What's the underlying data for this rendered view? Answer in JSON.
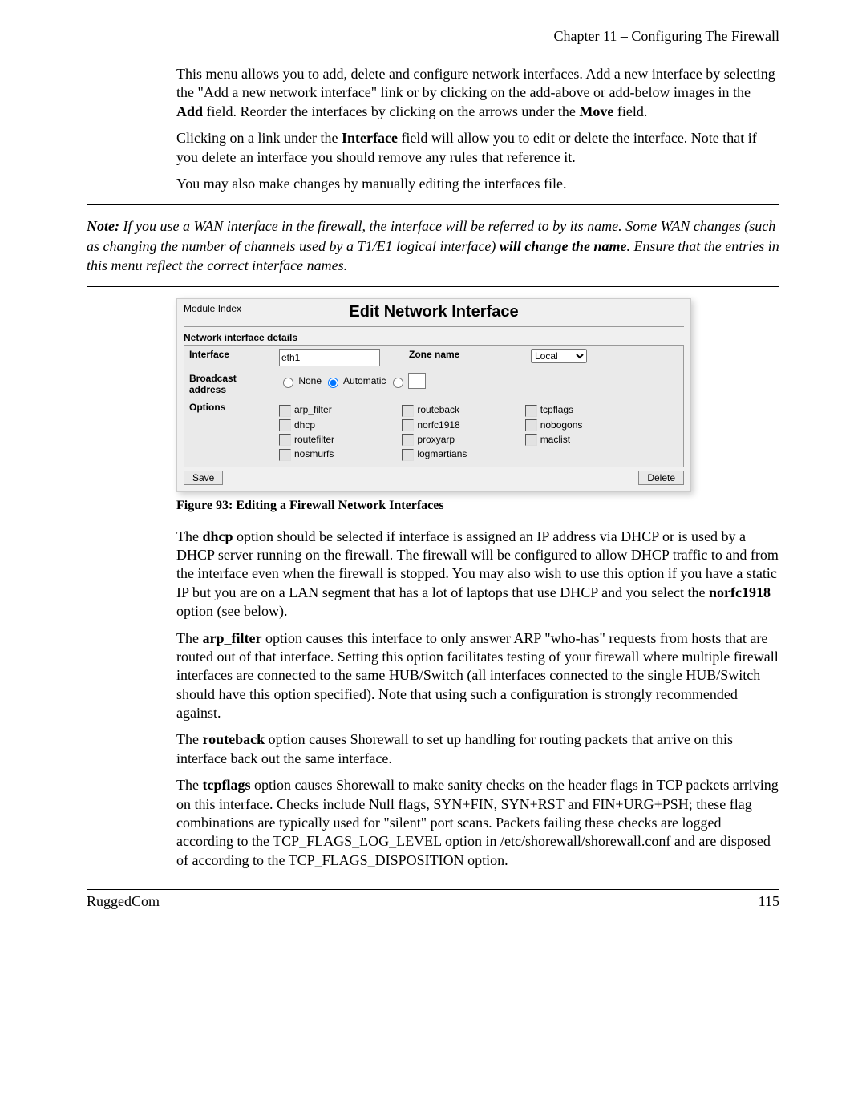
{
  "header": {
    "chapter": "Chapter 11 – Configuring The Firewall"
  },
  "intro": {
    "p1a": "This menu allows you to add, delete and configure network interfaces.  Add a new interface by selecting the \"Add a new network interface\" link or by clicking on the add-above or add-below images in the ",
    "p1b": "Add",
    "p1c": " field.  Reorder the interfaces by clicking on the arrows under the ",
    "p1d": "Move",
    "p1e": " field.",
    "p2a": "Clicking on a link under the ",
    "p2b": "Interface",
    "p2c": " field will allow you to edit or delete the interface.  Note that if you delete an interface you should remove any rules that reference it.",
    "p3": "You may also make changes by manually editing the interfaces file."
  },
  "note": {
    "label": "Note:",
    "t1": "  If you use a WAN interface in the firewall, the interface will be referred to by its name.  Some WAN changes (such as changing the number of channels used by a T1/E1 logical interface) ",
    "bold": "will change the name",
    "t2": ". Ensure that the entries in this menu reflect the correct interface names."
  },
  "panel": {
    "module_index": "Module Index",
    "title": "Edit Network Interface",
    "section": "Network interface details",
    "labels": {
      "interface": "Interface",
      "zone": "Zone name",
      "broadcast": "Broadcast address",
      "options": "Options"
    },
    "interface_value": "eth1",
    "zone_value": "Local",
    "broadcast": {
      "none": "None",
      "automatic": "Automatic",
      "selected": "automatic"
    },
    "options": {
      "col1": [
        "arp_filter",
        "dhcp",
        "routefilter",
        "nosmurfs"
      ],
      "col2": [
        "routeback",
        "norfc1918",
        "proxyarp",
        "logmartians"
      ],
      "col3": [
        "tcpflags",
        "nobogons",
        "maclist"
      ]
    },
    "buttons": {
      "save": "Save",
      "delete": "Delete"
    }
  },
  "figure_caption": "Figure 93: Editing a Firewall Network Interfaces",
  "body": {
    "p1a": "The ",
    "p1b": "dhcp",
    "p1c": " option should be selected if interface is assigned an IP address via DHCP or is used by a DHCP server running on the firewall. The firewall will be configured to allow DHCP traffic to and from the interface even when the firewall is stopped. You may also wish to use this option if you have a static IP but you are on a LAN segment that has a lot of laptops that use DHCP and you select the ",
    "p1d": "norfc1918",
    "p1e": " option (see below).",
    "p2a": "The ",
    "p2b": "arp_filter",
    "p2c": " option causes this interface to only answer ARP \"who-has\" requests from hosts that are routed out of that interface.  Setting this option facilitates testing of your firewall where multiple firewall interfaces are connected to the same HUB/Switch (all interfaces connected to the single HUB/Switch should have this option specified). Note that using such a configuration is strongly recommended against.",
    "p3a": "The ",
    "p3b": "routeback",
    "p3c": " option causes Shorewall to set up handling for routing packets that arrive on this interface back out the same interface.",
    "p4a": "The ",
    "p4b": "tcpflags",
    "p4c": " option causes Shorewall to make sanity checks on the header flags in TCP packets arriving on this interface. Checks include Null flags, SYN+FIN, SYN+RST and FIN+URG+PSH; these flag combinations are typically used for \"silent\" port scans. Packets failing these checks are logged according to the TCP_FLAGS_LOG_LEVEL option in /etc/shorewall/shorewall.conf and are disposed of according to the TCP_FLAGS_DISPOSITION option."
  },
  "footer": {
    "left": "RuggedCom",
    "right": "115"
  }
}
